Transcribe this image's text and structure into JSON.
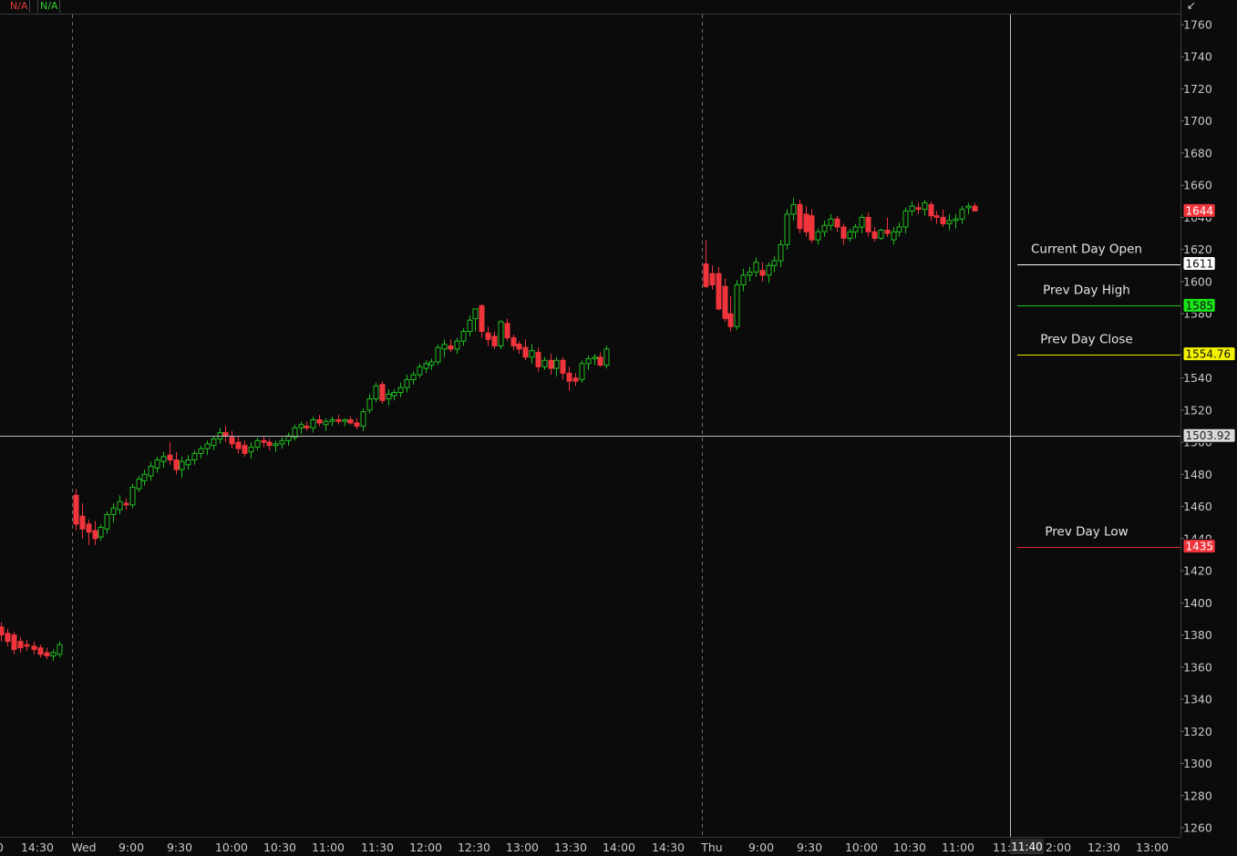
{
  "header": {
    "tags": [
      {
        "text": "N/A",
        "color": "#e23b3b"
      },
      {
        "text": "N/A",
        "color": "#2fcf2f"
      }
    ],
    "corner_glyph": "↙"
  },
  "colors": {
    "background": "#0b0b0b",
    "up": "#1fbf1f",
    "down": "#f0343c",
    "grid_line": "#7a7a7a",
    "axis_text": "#c8c8c8",
    "open_line": "#ffffff",
    "high_line": "#19c619",
    "close_line": "#e8e800",
    "low_line": "#e02a2a",
    "crosshair": "#bdbdbd"
  },
  "chart_data": {
    "type": "candlestick",
    "y_axis": {
      "min": 1250,
      "max": 1766,
      "ticks": [
        1760,
        1740,
        1720,
        1700,
        1680,
        1660,
        1640,
        1620,
        1600,
        1580,
        1540,
        1520,
        1500,
        1480,
        1460,
        1440,
        1420,
        1400,
        1380,
        1360,
        1340,
        1320,
        1300,
        1280,
        1260
      ]
    },
    "x_axis_labels": [
      "14:30",
      "Wed",
      "9:00",
      "9:30",
      "10:00",
      "10:30",
      "11:00",
      "11:30",
      "12:00",
      "12:30",
      "13:00",
      "13:30",
      "14:00",
      "14:30",
      "Thu",
      "9:00",
      "9:30",
      "10:00",
      "10:30",
      "11:00",
      "11:",
      "2:00",
      "12:30",
      "13:00"
    ],
    "x_axis_partial_label": "0",
    "cursor": {
      "time_label": "11:40",
      "price_label": "1503.92",
      "price": 1503.92
    },
    "price_badges": [
      {
        "value": "1644",
        "bg": "#f0343c",
        "fg": "#ffffff",
        "price": 1644
      },
      {
        "value": "1611",
        "bg": "#ffffff",
        "fg": "#111111",
        "price": 1611
      },
      {
        "value": "1585",
        "bg": "#19e619",
        "fg": "#111111",
        "price": 1585
      },
      {
        "value": "1554.76",
        "bg": "#f2f200",
        "fg": "#111111",
        "price": 1554.76
      },
      {
        "value": "1435",
        "bg": "#f0343c",
        "fg": "#ffffff",
        "price": 1435
      }
    ],
    "levels": [
      {
        "label": "Current Day Open",
        "price": 1611,
        "color": "#ffffff"
      },
      {
        "label": "Prev Day High",
        "price": 1585,
        "color": "#19c619"
      },
      {
        "label": "Prev Day Close",
        "price": 1554.76,
        "color": "#e8e800"
      },
      {
        "label": "Prev Day Low",
        "price": 1435,
        "color": "#e02a2a"
      }
    ],
    "sessions": [
      {
        "name": "prior",
        "start": 1,
        "step": 7.1,
        "candles": [
          [
            1385,
            1388,
            1376,
            1380
          ],
          [
            1381,
            1384,
            1373,
            1376
          ],
          [
            1380,
            1382,
            1368,
            1371
          ],
          [
            1376,
            1379,
            1369,
            1372
          ],
          [
            1374,
            1377,
            1370,
            1373
          ],
          [
            1373,
            1376,
            1368,
            1371
          ],
          [
            1372,
            1374,
            1366,
            1368
          ],
          [
            1369,
            1372,
            1365,
            1367
          ],
          [
            1367,
            1371,
            1364,
            1369
          ],
          [
            1368,
            1376,
            1366,
            1374
          ]
        ]
      },
      {
        "name": "wed",
        "start": 83,
        "step": 6.85,
        "candles": [
          [
            1467,
            1471,
            1445,
            1449
          ],
          [
            1454,
            1462,
            1440,
            1446
          ],
          [
            1449,
            1452,
            1436,
            1444
          ],
          [
            1445,
            1451,
            1436,
            1440
          ],
          [
            1441,
            1449,
            1439,
            1447
          ],
          [
            1446,
            1457,
            1443,
            1455
          ],
          [
            1455,
            1462,
            1450,
            1459
          ],
          [
            1458,
            1467,
            1455,
            1463
          ],
          [
            1462,
            1465,
            1458,
            1461
          ],
          [
            1461,
            1474,
            1459,
            1472
          ],
          [
            1471,
            1479,
            1469,
            1477
          ],
          [
            1476,
            1483,
            1473,
            1480
          ],
          [
            1479,
            1488,
            1476,
            1485
          ],
          [
            1484,
            1491,
            1481,
            1489
          ],
          [
            1488,
            1494,
            1484,
            1491
          ],
          [
            1492,
            1500,
            1486,
            1489
          ],
          [
            1489,
            1494,
            1480,
            1483
          ],
          [
            1483,
            1491,
            1478,
            1488
          ],
          [
            1486,
            1492,
            1483,
            1489
          ],
          [
            1489,
            1495,
            1486,
            1493
          ],
          [
            1493,
            1498,
            1490,
            1496
          ],
          [
            1496,
            1501,
            1492,
            1499
          ],
          [
            1498,
            1504,
            1495,
            1502
          ],
          [
            1502,
            1509,
            1499,
            1506
          ],
          [
            1506,
            1510,
            1500,
            1504
          ],
          [
            1503,
            1507,
            1496,
            1499
          ],
          [
            1500,
            1504,
            1493,
            1496
          ],
          [
            1498,
            1501,
            1491,
            1493
          ],
          [
            1494,
            1500,
            1490,
            1497
          ],
          [
            1497,
            1503,
            1495,
            1501
          ],
          [
            1501,
            1504,
            1497,
            1500
          ],
          [
            1500,
            1502,
            1495,
            1498
          ],
          [
            1498,
            1501,
            1494,
            1499
          ],
          [
            1499,
            1503,
            1496,
            1501
          ],
          [
            1501,
            1506,
            1498,
            1504
          ],
          [
            1503,
            1511,
            1501,
            1509
          ],
          [
            1509,
            1513,
            1505,
            1511
          ],
          [
            1510,
            1513,
            1507,
            1509
          ],
          [
            1509,
            1516,
            1506,
            1514
          ],
          [
            1514,
            1517,
            1510,
            1512
          ],
          [
            1511,
            1515,
            1507,
            1513
          ],
          [
            1513,
            1516,
            1510,
            1514
          ],
          [
            1514,
            1517,
            1511,
            1513
          ],
          [
            1513,
            1515,
            1510,
            1514
          ],
          [
            1514,
            1516,
            1511,
            1512
          ],
          [
            1512,
            1515,
            1508,
            1510
          ],
          [
            1510,
            1521,
            1507,
            1519
          ],
          [
            1520,
            1530,
            1518,
            1527
          ],
          [
            1527,
            1537,
            1525,
            1535
          ],
          [
            1536,
            1538,
            1524,
            1526
          ],
          [
            1527,
            1533,
            1523,
            1530
          ],
          [
            1529,
            1533,
            1526,
            1531
          ],
          [
            1531,
            1537,
            1528,
            1534
          ],
          [
            1534,
            1542,
            1531,
            1539
          ],
          [
            1539,
            1544,
            1536,
            1542
          ],
          [
            1542,
            1549,
            1540,
            1547
          ],
          [
            1546,
            1551,
            1543,
            1549
          ],
          [
            1548,
            1552,
            1545,
            1550
          ],
          [
            1550,
            1561,
            1548,
            1559
          ],
          [
            1558,
            1564,
            1553,
            1561
          ],
          [
            1560,
            1564,
            1556,
            1558
          ],
          [
            1558,
            1565,
            1555,
            1563
          ],
          [
            1563,
            1571,
            1560,
            1569
          ],
          [
            1569,
            1579,
            1566,
            1576
          ],
          [
            1577,
            1583,
            1569,
            1583
          ],
          [
            1585,
            1586,
            1565,
            1569
          ],
          [
            1568,
            1572,
            1560,
            1564
          ],
          [
            1566,
            1569,
            1558,
            1560
          ],
          [
            1560,
            1576,
            1558,
            1575
          ],
          [
            1574,
            1577,
            1563,
            1565
          ],
          [
            1565,
            1567,
            1557,
            1560
          ],
          [
            1561,
            1563,
            1555,
            1558
          ],
          [
            1559,
            1564,
            1551,
            1553
          ],
          [
            1553,
            1561,
            1549,
            1557
          ],
          [
            1556,
            1559,
            1544,
            1547
          ],
          [
            1547,
            1553,
            1545,
            1551
          ],
          [
            1551,
            1555,
            1542,
            1546
          ],
          [
            1546,
            1553,
            1541,
            1551
          ],
          [
            1551,
            1553,
            1539,
            1543
          ],
          [
            1543,
            1547,
            1532,
            1538
          ],
          [
            1540,
            1543,
            1535,
            1538
          ],
          [
            1539,
            1551,
            1537,
            1549
          ],
          [
            1549,
            1554,
            1545,
            1552
          ],
          [
            1552,
            1555,
            1548,
            1553
          ],
          [
            1553,
            1556,
            1547,
            1548
          ],
          [
            1548,
            1560,
            1546,
            1558
          ]
        ]
      },
      {
        "name": "thu",
        "start": 774,
        "step": 6.85,
        "candles": [
          [
            1611,
            1626,
            1596,
            1597
          ],
          [
            1605,
            1610,
            1595,
            1598
          ],
          [
            1605,
            1609,
            1582,
            1583
          ],
          [
            1597,
            1602,
            1575,
            1577
          ],
          [
            1580,
            1591,
            1569,
            1572
          ],
          [
            1572,
            1601,
            1570,
            1598
          ],
          [
            1598,
            1608,
            1594,
            1604
          ],
          [
            1604,
            1609,
            1600,
            1606
          ],
          [
            1606,
            1615,
            1603,
            1612
          ],
          [
            1607,
            1612,
            1600,
            1604
          ],
          [
            1604,
            1612,
            1599,
            1610
          ],
          [
            1610,
            1616,
            1606,
            1613
          ],
          [
            1613,
            1626,
            1609,
            1623
          ],
          [
            1623,
            1645,
            1620,
            1642
          ],
          [
            1642,
            1652,
            1638,
            1648
          ],
          [
            1648,
            1651,
            1630,
            1633
          ],
          [
            1642,
            1647,
            1628,
            1631
          ],
          [
            1641,
            1645,
            1624,
            1626
          ],
          [
            1626,
            1633,
            1623,
            1631
          ],
          [
            1631,
            1638,
            1628,
            1635
          ],
          [
            1635,
            1642,
            1632,
            1639
          ],
          [
            1639,
            1641,
            1631,
            1634
          ],
          [
            1634,
            1636,
            1623,
            1627
          ],
          [
            1627,
            1633,
            1625,
            1631
          ],
          [
            1631,
            1636,
            1627,
            1634
          ],
          [
            1634,
            1642,
            1630,
            1640
          ],
          [
            1640,
            1643,
            1628,
            1631
          ],
          [
            1631,
            1634,
            1625,
            1627
          ],
          [
            1627,
            1633,
            1626,
            1632
          ],
          [
            1632,
            1640,
            1628,
            1630
          ],
          [
            1626,
            1634,
            1623,
            1631
          ],
          [
            1631,
            1637,
            1628,
            1634
          ],
          [
            1634,
            1646,
            1630,
            1644
          ],
          [
            1644,
            1650,
            1641,
            1647
          ],
          [
            1646,
            1649,
            1642,
            1645
          ],
          [
            1645,
            1651,
            1641,
            1649
          ],
          [
            1648,
            1650,
            1638,
            1641
          ],
          [
            1641,
            1644,
            1636,
            1640
          ],
          [
            1640,
            1645,
            1634,
            1636
          ],
          [
            1636,
            1642,
            1632,
            1638
          ],
          [
            1638,
            1642,
            1633,
            1639
          ],
          [
            1639,
            1647,
            1636,
            1645
          ],
          [
            1646,
            1649,
            1642,
            1647
          ],
          [
            1647,
            1649,
            1644,
            1644
          ]
        ]
      }
    ]
  }
}
